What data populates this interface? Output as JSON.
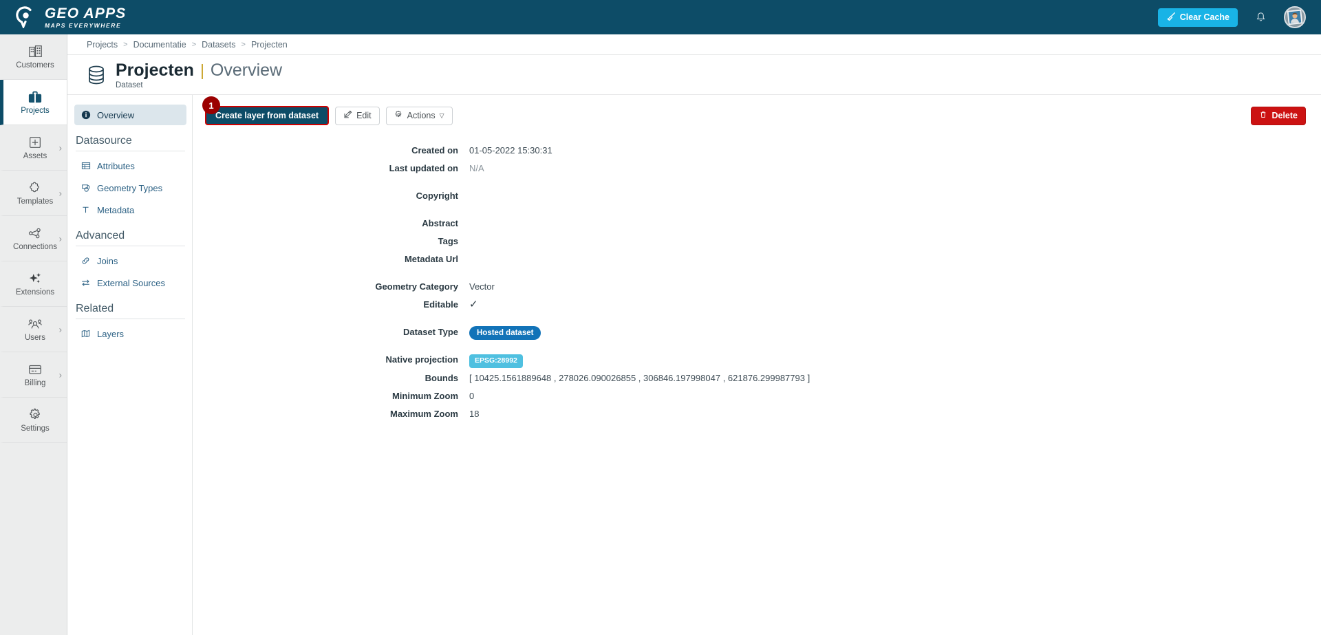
{
  "topbar": {
    "brand_title": "GEO APPS",
    "brand_sub": "MAPS EVERYWHERE",
    "brand_icon": "map-pin-logo-icon",
    "clear_cache_label": "Clear Cache",
    "clear_cache_icon": "broom-icon",
    "clear_cache_color": "#19b3e6",
    "bell_icon": "notification-bell-icon",
    "avatar_icon": "user-avatar-photo",
    "background_color": "#0d4c67"
  },
  "rail": {
    "items": [
      {
        "label": "Customers",
        "icon": "buildings-icon",
        "active": false,
        "chevron": false
      },
      {
        "label": "Projects",
        "icon": "briefcase-icon",
        "active": true,
        "chevron": false
      },
      {
        "label": "Assets",
        "icon": "plus-square-icon",
        "active": false,
        "chevron": true
      },
      {
        "label": "Templates",
        "icon": "puzzle-piece-icon",
        "active": false,
        "chevron": true
      },
      {
        "label": "Connections",
        "icon": "nodes-graph-icon",
        "active": false,
        "chevron": true
      },
      {
        "label": "Extensions",
        "icon": "sparkles-icon",
        "active": false,
        "chevron": false
      },
      {
        "label": "Users",
        "icon": "users-group-icon",
        "active": false,
        "chevron": true
      },
      {
        "label": "Billing",
        "icon": "credit-card-icon",
        "active": false,
        "chevron": true
      },
      {
        "label": "Settings",
        "icon": "gear-icon",
        "active": false,
        "chevron": false
      }
    ],
    "chevron_glyph": "›"
  },
  "breadcrumb": {
    "separator": ">",
    "items": [
      "Projects",
      "Documentatie",
      "Datasets",
      "Projecten"
    ]
  },
  "page_head": {
    "icon": "database-cylinder-icon",
    "title": "Projecten",
    "divider": "|",
    "section": "Overview",
    "subtitle": "Dataset"
  },
  "secnav": {
    "overview": {
      "label": "Overview",
      "icon": "info-circle-icon"
    },
    "groups": [
      {
        "title": "Datasource",
        "items": [
          {
            "label": "Attributes",
            "icon": "table-icon"
          },
          {
            "label": "Geometry Types",
            "icon": "shapes-icon"
          },
          {
            "label": "Metadata",
            "icon": "text-t-icon"
          }
        ]
      },
      {
        "title": "Advanced",
        "items": [
          {
            "label": "Joins",
            "icon": "link-chain-icon"
          },
          {
            "label": "External Sources",
            "icon": "exchange-arrows-icon"
          }
        ]
      },
      {
        "title": "Related",
        "items": [
          {
            "label": "Layers",
            "icon": "map-layers-icon"
          }
        ]
      }
    ]
  },
  "toolbar": {
    "step_badge": "1",
    "create_layer_label": "Create layer from dataset",
    "edit_label": "Edit",
    "edit_icon": "pencil-square-icon",
    "actions_label": "Actions",
    "actions_icon": "gear-icon",
    "actions_caret": "▽",
    "delete_label": "Delete",
    "delete_icon": "trash-icon",
    "highlight_color": "#cc0000",
    "primary_color": "#0d4c67",
    "danger_color": "#cc1212"
  },
  "details": [
    {
      "label": "Created on",
      "value": "01-05-2022 15:30:31",
      "type": "text"
    },
    {
      "label": "Last updated on",
      "value": "N/A",
      "type": "muted"
    },
    {
      "label": "Copyright",
      "value": "",
      "type": "text",
      "gap": true
    },
    {
      "label": "Abstract",
      "value": "",
      "type": "text",
      "gap": true
    },
    {
      "label": "Tags",
      "value": "",
      "type": "text"
    },
    {
      "label": "Metadata Url",
      "value": "",
      "type": "text"
    },
    {
      "label": "Geometry Category",
      "value": "Vector",
      "type": "text",
      "gap": true
    },
    {
      "label": "Editable",
      "value": "✓",
      "type": "check"
    },
    {
      "label": "Dataset Type",
      "value": "Hosted dataset",
      "type": "badge-hosted",
      "gap": true
    },
    {
      "label": "Native projection",
      "value": "EPSG:28992",
      "type": "badge-epsg",
      "gap": true
    },
    {
      "label": "Bounds",
      "value": "[ 10425.1561889648 , 278026.090026855 , 306846.197998047 , 621876.299987793 ]",
      "type": "text"
    },
    {
      "label": "Minimum Zoom",
      "value": "0",
      "type": "text"
    },
    {
      "label": "Maximum Zoom",
      "value": "18",
      "type": "text"
    }
  ]
}
